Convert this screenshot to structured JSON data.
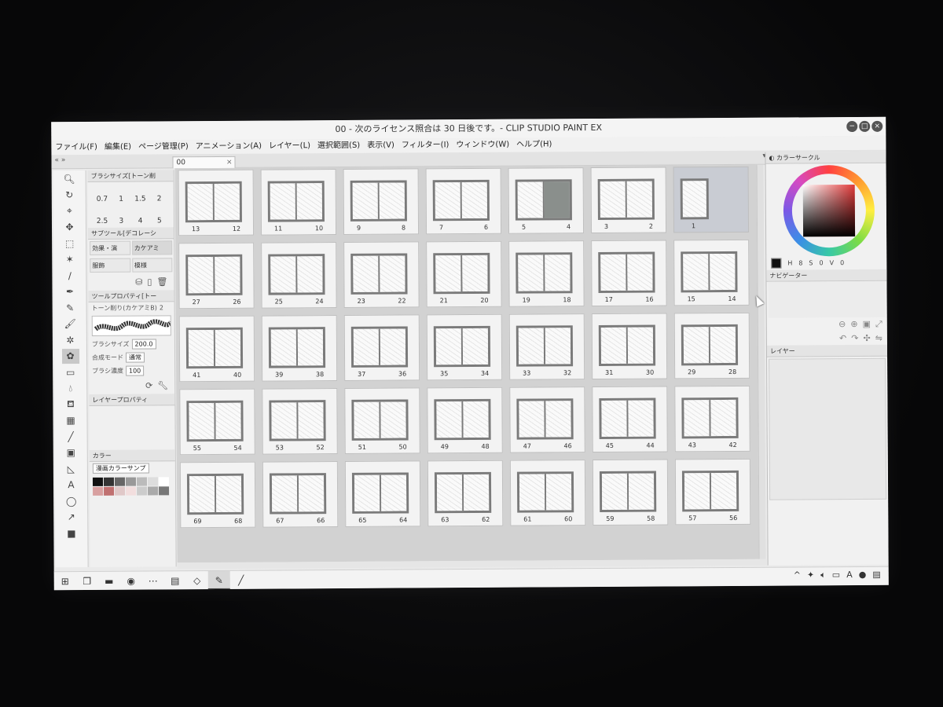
{
  "window": {
    "title": "00 - 次のライセンス照合は 30 日後です。- CLIP STUDIO PAINT EX",
    "controls": [
      "−",
      "□",
      "×"
    ]
  },
  "menu": [
    "ファイル(F)",
    "編集(E)",
    "ページ管理(P)",
    "アニメーション(A)",
    "レイヤー(L)",
    "選択範囲(S)",
    "表示(V)",
    "フィルター(I)",
    "ウィンドウ(W)",
    "ヘルプ(H)"
  ],
  "document_tab": {
    "label": "00",
    "close": "×"
  },
  "tab_arrows_left": "«  »",
  "tab_arrows_right": "▾  «",
  "left_panel": {
    "brush_size_title": "ブラシサイズ[トーン削",
    "brush_sizes": [
      "0.7",
      "1",
      "1.5",
      "2",
      "2.5",
      "3",
      "4",
      "5"
    ],
    "subtool_title": "サブツール[デコレーシ",
    "subtool_tabs": [
      "効果・演",
      "カケアミ",
      "服飾",
      "模様"
    ],
    "tool_property_title": "ツールプロパティ[トー",
    "brush_name": "トーン削り(カケアミB)",
    "brush_num": "2",
    "brush_size_label": "ブラシサイズ",
    "brush_size_value": "200.0",
    "blend_mode_label": "合成モード",
    "blend_mode_value": "通常",
    "brush_density_label": "ブラシ濃度",
    "brush_density_value": "100",
    "layer_property_title": "レイヤープロパティ",
    "color_set_tab": "カラー",
    "color_set_select": "漫画カラーサンプ"
  },
  "pages": [
    [
      [
        "13",
        "12"
      ],
      [
        "11",
        "10"
      ],
      [
        "9",
        "8"
      ],
      [
        "7",
        "6"
      ],
      [
        "5",
        "4"
      ],
      [
        "3",
        "2"
      ],
      [
        "1"
      ]
    ],
    [
      [
        "27",
        "26"
      ],
      [
        "25",
        "24"
      ],
      [
        "23",
        "22"
      ],
      [
        "21",
        "20"
      ],
      [
        "19",
        "18"
      ],
      [
        "17",
        "16"
      ],
      [
        "15",
        "14"
      ]
    ],
    [
      [
        "41",
        "40"
      ],
      [
        "39",
        "38"
      ],
      [
        "37",
        "36"
      ],
      [
        "35",
        "34"
      ],
      [
        "33",
        "32"
      ],
      [
        "31",
        "30"
      ],
      [
        "29",
        "28"
      ]
    ],
    [
      [
        "55",
        "54"
      ],
      [
        "53",
        "52"
      ],
      [
        "51",
        "50"
      ],
      [
        "49",
        "48"
      ],
      [
        "47",
        "46"
      ],
      [
        "45",
        "44"
      ],
      [
        "43",
        "42"
      ]
    ],
    [
      [
        "69",
        "68"
      ],
      [
        "67",
        "66"
      ],
      [
        "65",
        "64"
      ],
      [
        "63",
        "62"
      ],
      [
        "61",
        "60"
      ],
      [
        "59",
        "58"
      ],
      [
        "57",
        "56"
      ]
    ]
  ],
  "right_panel": {
    "color_circle_title": "カラーサークル",
    "color_values": [
      "H",
      "8",
      "S",
      "0",
      "V",
      "0"
    ],
    "navigator_title": "ナビゲーター",
    "layer_title": "レイヤー"
  },
  "taskbar": {
    "start_icon": "⊞",
    "tray_chevron": "^",
    "tray_ime": "A"
  }
}
